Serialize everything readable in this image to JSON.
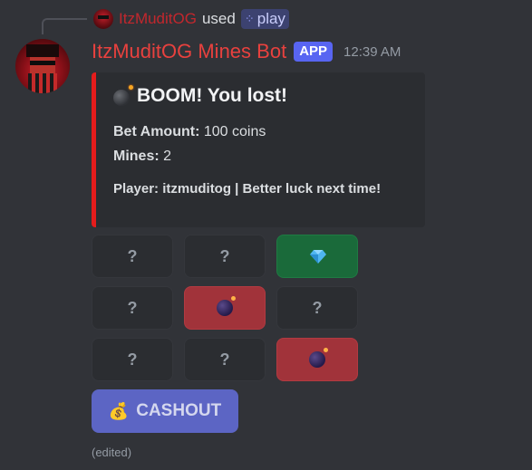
{
  "reply": {
    "user": "ItzMuditOG",
    "verb": "used",
    "command_icon": "slash-command-icon",
    "command": "play"
  },
  "message": {
    "author": "ItzMuditOG Mines Bot",
    "badge": "APP",
    "timestamp": "12:39 AM",
    "edited": "(edited)"
  },
  "embed": {
    "accent_color": "#e51c1c",
    "title": "BOOM! You lost!",
    "fields": [
      {
        "name": "Bet Amount:",
        "value": "100 coins"
      },
      {
        "name": "Mines:",
        "value": "2"
      }
    ],
    "footer": "Player: itzmuditog | Better luck next time!"
  },
  "grid": {
    "unrevealed_label": "?",
    "rows": [
      [
        "?",
        "?",
        "gem"
      ],
      [
        "?",
        "bomb",
        "?"
      ],
      [
        "?",
        "?",
        "bomb"
      ]
    ]
  },
  "cashout": {
    "icon": "money-bag-icon",
    "label": "CASHOUT"
  },
  "colors": {
    "background": "#313338",
    "gem_tile": "#1a6a3a",
    "bomb_tile": "#a1333a",
    "cashout": "#5c65c4",
    "bot_name": "#e8413e"
  }
}
